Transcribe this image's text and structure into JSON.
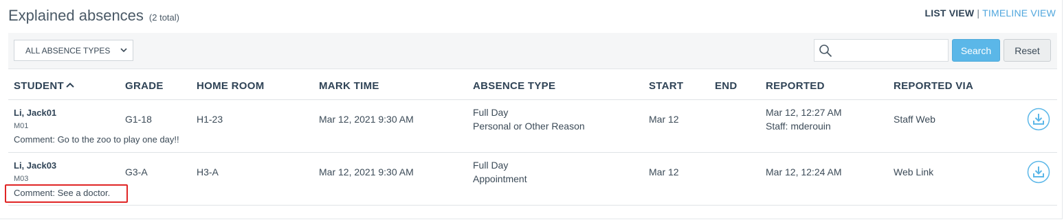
{
  "header": {
    "title": "Explained absences",
    "count": "(2 total)",
    "list_view": "LIST VIEW",
    "separator": "|",
    "timeline_view": "TIMELINE VIEW"
  },
  "filters": {
    "absence_type_selected": "ALL ABSENCE TYPES",
    "search_value": "",
    "search_button": "Search",
    "reset_button": "Reset"
  },
  "table": {
    "columns": [
      "STUDENT",
      "GRADE",
      "HOME ROOM",
      "MARK TIME",
      "ABSENCE TYPE",
      "START",
      "END",
      "REPORTED",
      "REPORTED VIA"
    ],
    "rows": [
      {
        "student_name": "Li, Jack01",
        "student_id": "M01",
        "grade": "G1-18",
        "home_room": "H1-23",
        "mark_time": "Mar 12, 2021 9:30 AM",
        "absence_type_line1": "Full Day",
        "absence_type_line2": "Personal or Other Reason",
        "start": "Mar 12",
        "end": "",
        "reported_line1": "Mar 12, 12:27 AM",
        "reported_line2": "Staff: mderouin",
        "reported_via": "Staff Web",
        "comment": "Comment: Go to the zoo to play one day!!"
      },
      {
        "student_name": "Li, Jack03",
        "student_id": "M03",
        "grade": "G3-A",
        "home_room": "H3-A",
        "mark_time": "Mar 12, 2021 9:30 AM",
        "absence_type_line1": "Full Day",
        "absence_type_line2": "Appointment",
        "start": "Mar 12",
        "end": "",
        "reported_line1": "Mar 12, 12:24 AM",
        "reported_line2": "",
        "reported_via": "Web Link",
        "comment": "Comment: See a doctor."
      }
    ]
  },
  "icons": {
    "sort": "chevron-up-icon",
    "search": "search-icon",
    "download": "download-icon",
    "select": "chevron-down-icon"
  },
  "colors": {
    "accent": "#5bb7e8",
    "link": "#4fa6dd",
    "header_text": "#2f4356",
    "highlight": "#e02424"
  }
}
